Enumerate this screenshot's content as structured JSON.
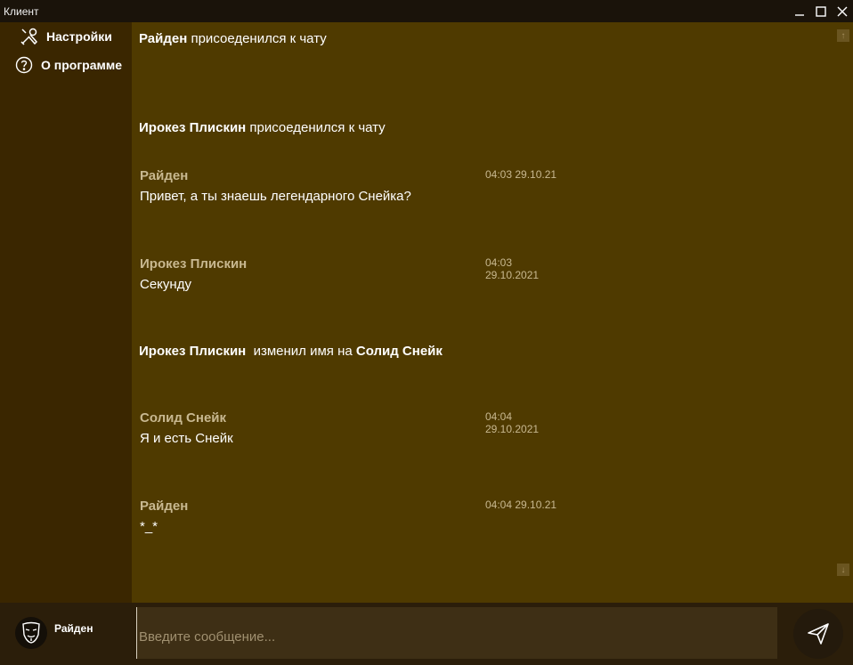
{
  "window": {
    "title": "Клиент"
  },
  "sidebar": {
    "items": [
      {
        "label": "Настройки",
        "icon": "tools-icon"
      },
      {
        "label": "О программе",
        "icon": "question-circle-icon"
      }
    ]
  },
  "chat": {
    "events": [
      {
        "type": "system",
        "name": "Райден",
        "text": "присоеденился к чату"
      },
      {
        "type": "system",
        "name": "Ирокез Плискин",
        "text": "присоеденился к чату"
      },
      {
        "type": "message",
        "author": "Райден",
        "time": "04:03 29.10.21",
        "text": "Привет, а ты знаешь легендарного Снейка?"
      },
      {
        "type": "message",
        "author": "Ирокез Плискин",
        "time": "04:03 29.10.2021",
        "text": "Секунду"
      },
      {
        "type": "rename",
        "name": "Ирокез Плискин",
        "text": "изменил имя на",
        "new_name": "Солид Снейк"
      },
      {
        "type": "message",
        "author": "Солид Снейк",
        "time": "04:04 29.10.2021",
        "text": "Я и есть Снейк"
      },
      {
        "type": "message",
        "author": "Райден",
        "time": "04:04 29.10.21",
        "text": "*_*"
      }
    ]
  },
  "bottom": {
    "username": "Райден",
    "input_placeholder": "Введите сообщение...",
    "input_value": ""
  },
  "colors": {
    "sidebar": "#3a2600",
    "chat": "#4f3a00",
    "bottombar": "#2b1e0a",
    "author": "#c8b890"
  }
}
